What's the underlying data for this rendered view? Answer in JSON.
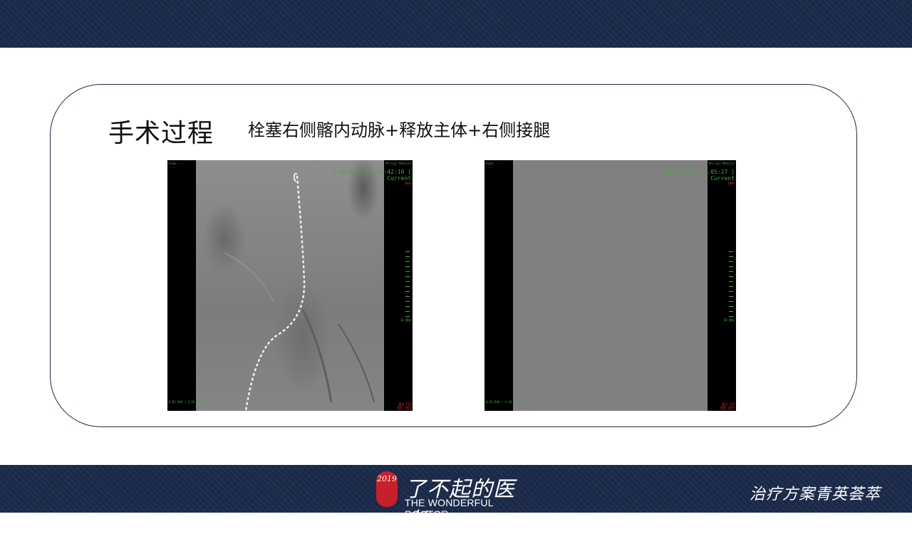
{
  "slide": {
    "title": "手术过程",
    "subtitle": "栓塞右侧髂内动脉+释放主体+右侧接腿"
  },
  "images": {
    "left": {
      "overlay_tl": "Exam: ...\n....",
      "overlay_tr": "Philips Medical",
      "timestamp": "[ 2019-4-19, 15:42:10 ]",
      "status": "Current",
      "zoom": "100%",
      "ruler_label": "10 厘米",
      "bottom_left": "0.01 RAO / 4.38 CAU",
      "bottom_right": "窗位 512\n窗宽 1024"
    },
    "right": {
      "overlay_tl": "Exam: ...\n....",
      "overlay_tr": "Philips Medical",
      "timestamp": "[ 2019-4-19, 17:05:27 ]",
      "status": "Current",
      "zoom": "100%",
      "ruler_label": "10 厘米",
      "bottom_left": "0.01 RAO / 4.38 CAU",
      "bottom_right": "窗位 512\n窗宽 1024"
    }
  },
  "footer": {
    "seal_text": "2019",
    "logo_cn": "了不起的医者",
    "logo_en": "THE WONDERFUL DOCTOR",
    "slogan": "治疗方案青英荟萃"
  },
  "colors": {
    "band": "#1b2a4a",
    "overlay_green": "#3fae3f",
    "overlay_red": "#e0302c",
    "seal_red": "#c8202a"
  }
}
